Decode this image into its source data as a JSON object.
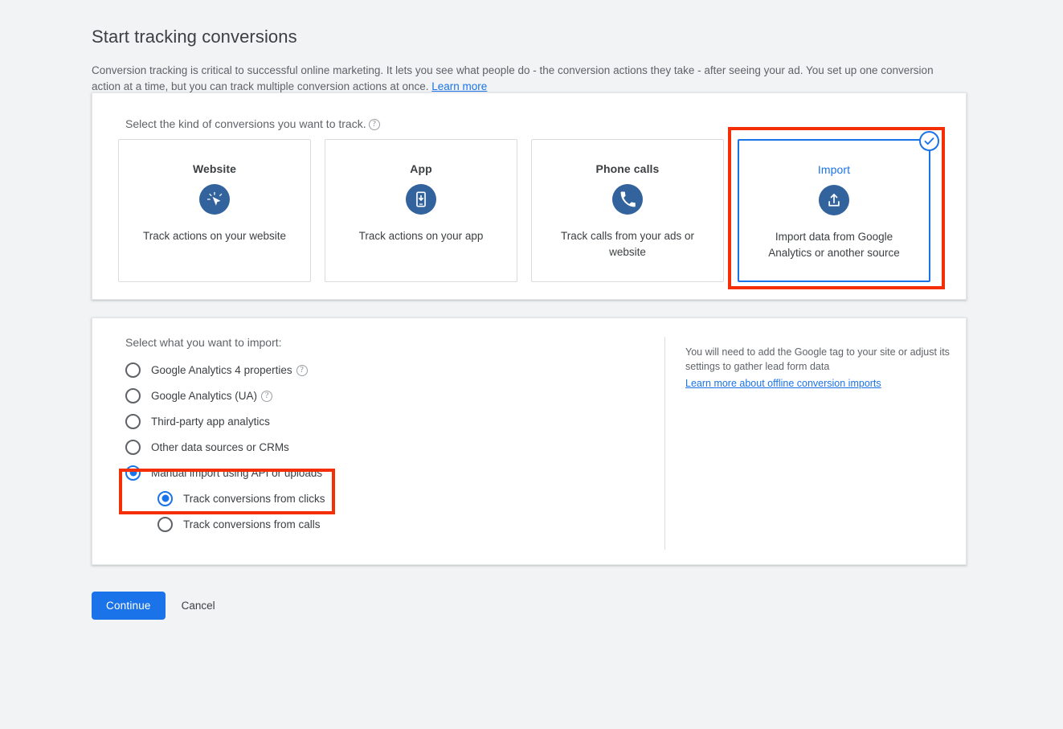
{
  "header": {
    "title": "Start tracking conversions",
    "intro_text": "Conversion tracking is critical to successful online marketing. It lets you see what people do - the conversion actions they take - after seeing your ad. You set up one conversion action at a time, but you can track multiple conversion actions at once. ",
    "learn_more": "Learn more"
  },
  "kind_section": {
    "label": "Select the kind of conversions you want to track.",
    "help_glyph": "?",
    "tiles": [
      {
        "title": "Website",
        "description": "Track actions on your website",
        "icon": "cursor-click-icon",
        "selected": false
      },
      {
        "title": "App",
        "description": "Track actions on your app",
        "icon": "mobile-download-icon",
        "selected": false
      },
      {
        "title": "Phone calls",
        "description": "Track calls from your ads or website",
        "icon": "phone-icon",
        "selected": false
      },
      {
        "title": "Import",
        "description": "Import data from Google Analytics or another source",
        "icon": "upload-icon",
        "selected": true
      }
    ]
  },
  "import_section": {
    "label": "Select what you want to import:",
    "options": [
      {
        "label": "Google Analytics 4 properties",
        "has_help": true,
        "checked": false,
        "indent": false
      },
      {
        "label": "Google Analytics (UA)",
        "has_help": true,
        "checked": false,
        "indent": false
      },
      {
        "label": "Third-party app analytics",
        "has_help": false,
        "checked": false,
        "indent": false
      },
      {
        "label": "Other data sources or CRMs",
        "has_help": false,
        "checked": false,
        "indent": false
      },
      {
        "label": "Manual import using API or uploads",
        "has_help": false,
        "checked": true,
        "indent": false
      },
      {
        "label": "Track conversions from clicks",
        "has_help": false,
        "checked": true,
        "indent": true
      },
      {
        "label": "Track conversions from calls",
        "has_help": false,
        "checked": false,
        "indent": true
      }
    ],
    "side_note": "You will need to add the Google tag to your site or adjust its settings to gather lead form data",
    "side_link": "Learn more about offline conversion imports"
  },
  "footer": {
    "continue_label": "Continue",
    "cancel_label": "Cancel"
  },
  "colors": {
    "accent_blue": "#1a73e8",
    "icon_blue": "#33639c",
    "annotation_red": "#f42f05",
    "page_bg": "#f1f3f4",
    "text_primary": "#3c4043",
    "text_secondary": "#5f6368"
  }
}
